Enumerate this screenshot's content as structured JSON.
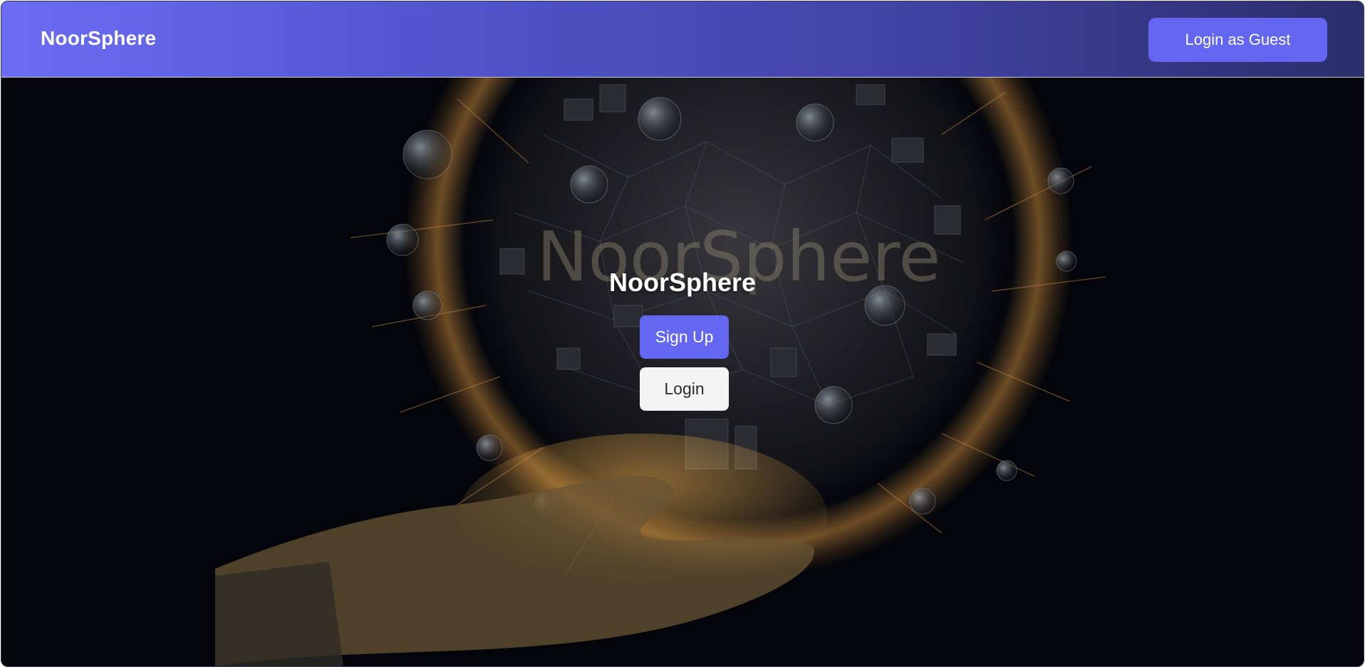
{
  "navbar": {
    "brand": "NoorSphere",
    "guest_login_label": "Login as Guest"
  },
  "hero": {
    "title": "NoorSphere",
    "background_art_text": "NoorSphere",
    "signup_label": "Sign Up",
    "login_label": "Login"
  },
  "colors": {
    "primary": "#6366f1",
    "navbar_gradient_start": "#6c6cf4",
    "navbar_gradient_end": "#2a2e6a",
    "hero_background": "#03050b",
    "glow": "#f0a446"
  }
}
